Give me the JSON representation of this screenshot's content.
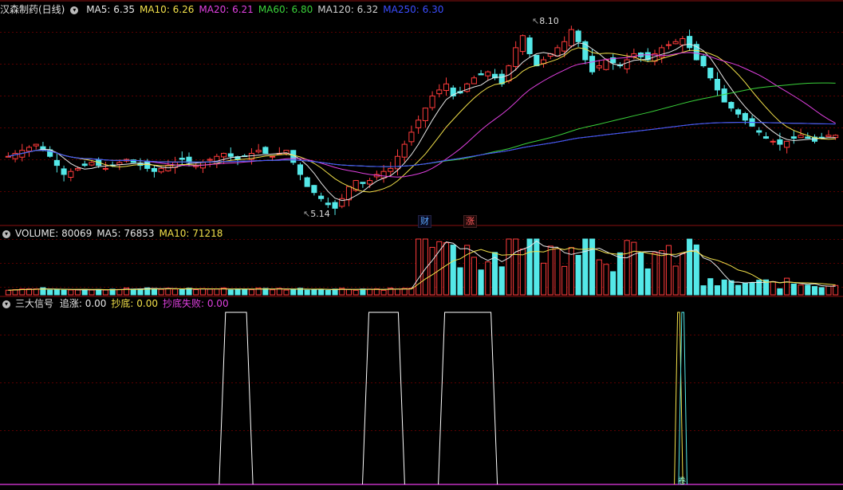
{
  "price_panel": {
    "title": "汉森制药(日线)",
    "indicators": [
      {
        "name": "MA5",
        "value": "6.35",
        "color": "#e6e6e6"
      },
      {
        "name": "MA10",
        "value": "6.26",
        "color": "#f2e04a"
      },
      {
        "name": "MA20",
        "value": "6.21",
        "color": "#e040e0"
      },
      {
        "name": "MA60",
        "value": "6.80",
        "color": "#3ad23a"
      },
      {
        "name": "MA120",
        "value": "6.32",
        "color": "#cfcfcf"
      },
      {
        "name": "MA250",
        "value": "6.30",
        "color": "#3b4dff"
      }
    ],
    "high_label": "8.10",
    "low_label": "5.14",
    "tags": [
      {
        "text": "财",
        "color": "#5aa8ff"
      },
      {
        "text": "涨",
        "color": "#ff5a5a"
      }
    ]
  },
  "volume_panel": {
    "title": "VOLUME",
    "indicators": [
      {
        "name": "VOLUME",
        "value": "80069",
        "color": "#e6e6e6"
      },
      {
        "name": "MA5",
        "value": "76853",
        "color": "#e6e6e6"
      },
      {
        "name": "MA10",
        "value": "71218",
        "color": "#f2e04a"
      }
    ]
  },
  "signal_panel": {
    "title": "三大信号",
    "indicators": [
      {
        "name": "追涨",
        "value": "0.00",
        "color": "#e6e6e6"
      },
      {
        "name": "抄底",
        "value": "0.00",
        "color": "#f2e04a"
      },
      {
        "name": "抄底失败",
        "value": "0.00",
        "color": "#e040e0"
      }
    ],
    "bottom_tag": "卷"
  },
  "chart_data": [
    {
      "type": "candlestick",
      "title": "汉森制药(日线)",
      "series_close_approx": [
        6.0,
        6.05,
        6.1,
        6.15,
        6.2,
        6.1,
        6.0,
        5.85,
        5.7,
        5.75,
        5.8,
        5.85,
        5.9,
        5.85,
        5.8,
        5.85,
        5.9,
        5.95,
        5.9,
        5.85,
        5.8,
        5.75,
        5.8,
        5.85,
        5.9,
        5.95,
        5.9,
        5.85,
        5.9,
        5.95,
        6.0,
        6.05,
        6.0,
        5.95,
        6.0,
        6.05,
        6.1,
        6.05,
        6.0,
        6.05,
        6.1,
        5.9,
        5.7,
        5.5,
        5.4,
        5.3,
        5.2,
        5.14,
        5.3,
        5.5,
        5.6,
        5.55,
        5.6,
        5.7,
        5.75,
        5.8,
        6.0,
        6.2,
        6.4,
        6.6,
        6.8,
        7.0,
        7.1,
        7.2,
        7.0,
        7.05,
        7.2,
        7.3,
        7.35,
        7.4,
        7.3,
        7.2,
        7.5,
        7.8,
        8.0,
        7.7,
        7.5,
        7.6,
        7.7,
        7.8,
        7.9,
        8.1,
        7.9,
        7.6,
        7.4,
        7.5,
        7.6,
        7.55,
        7.5,
        7.6,
        7.7,
        7.65,
        7.6,
        7.7,
        7.8,
        7.85,
        7.9,
        7.95,
        7.8,
        7.6,
        7.5,
        7.3,
        7.1,
        6.9,
        6.8,
        6.7,
        6.6,
        6.5,
        6.4,
        6.3,
        6.25,
        6.2,
        6.25,
        6.3,
        6.35,
        6.3,
        6.25,
        6.3,
        6.35,
        6.35
      ],
      "labels": {
        "high": "8.10",
        "low": "5.14"
      },
      "ma": {
        "MA5": 6.35,
        "MA10": 6.26,
        "MA20": 6.21,
        "MA60": 6.8,
        "MA120": 6.32,
        "MA250": 6.3
      }
    },
    {
      "type": "bar",
      "title": "VOLUME",
      "latest": {
        "VOLUME": 80069,
        "MA5": 76853,
        "MA10": 71218
      }
    },
    {
      "type": "line",
      "title": "三大信号",
      "series": [
        {
          "name": "追涨",
          "segments": [
            [
              0.26,
              0.3
            ],
            [
              0.43,
              0.48
            ],
            [
              0.52,
              0.59
            ]
          ],
          "value": 0.0
        },
        {
          "name": "抄底",
          "segments": [
            [
              0.8,
              0.81
            ]
          ],
          "value": 0.0
        },
        {
          "name": "抄底失败",
          "segments": [
            [
              0.805,
              0.815
            ]
          ],
          "value": 0.0
        }
      ]
    }
  ]
}
